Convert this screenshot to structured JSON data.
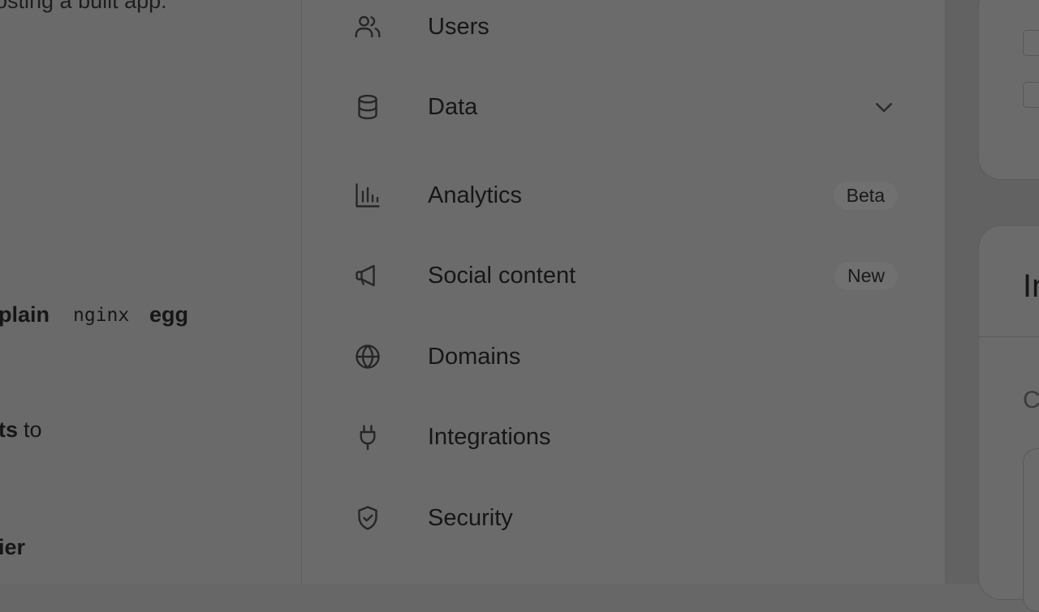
{
  "chat": {
    "line_top": "osting a built app.",
    "line_explain": "plain",
    "code_nginx": "nginx",
    "word_egg": "egg",
    "line_ts": "ts",
    "word_to": "to",
    "line_ier": "ier"
  },
  "menu": {
    "items": [
      {
        "label": "Users",
        "icon": "users-icon"
      },
      {
        "label": "Data",
        "icon": "database-icon"
      },
      {
        "label": "Analytics",
        "icon": "bar-chart-icon",
        "badge": "Beta"
      },
      {
        "label": "Social content",
        "icon": "megaphone-icon",
        "badge": "New"
      },
      {
        "label": "Domains",
        "icon": "globe-icon"
      },
      {
        "label": "Integrations",
        "icon": "plug-icon"
      },
      {
        "label": "Security",
        "icon": "shield-icon"
      }
    ]
  },
  "right": {
    "card_title": "In",
    "card_sub": "C"
  }
}
